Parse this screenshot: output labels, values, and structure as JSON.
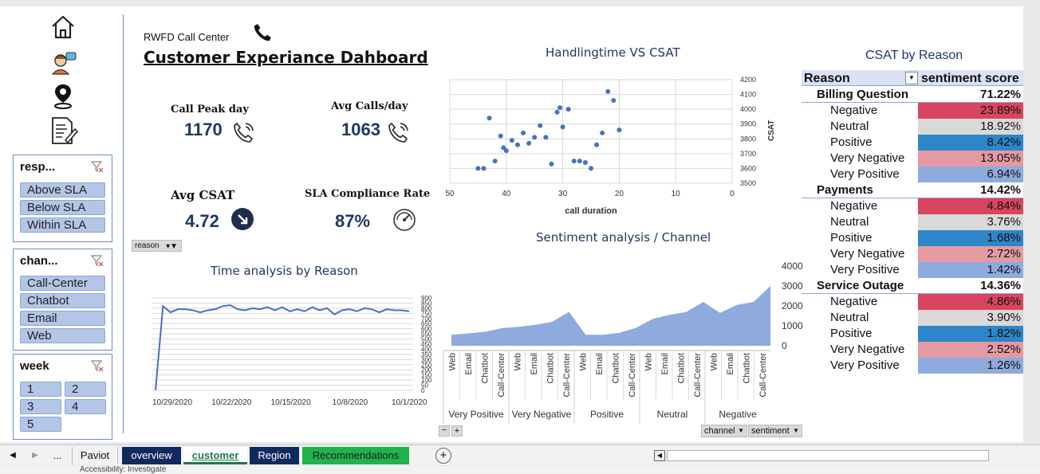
{
  "header": {
    "subtitle": "RWFD Call Center",
    "title": "Customer Experiance Dahboard"
  },
  "kpis": {
    "peak_label": "Call Peak day",
    "peak_value": "1170",
    "avg_calls_label": "Avg Calls/day",
    "avg_calls_value": "1063",
    "csat_label": "Avg CSAT",
    "csat_value": "4.72",
    "sla_label": "SLA Compliance Rate",
    "sla_value": "87%"
  },
  "slicers": {
    "response": {
      "title": "resp...",
      "items": [
        "Above SLA",
        "Below SLA",
        "Within SLA"
      ]
    },
    "channel": {
      "title": "chan...",
      "items": [
        "Call-Center",
        "Chatbot",
        "Email",
        "Web"
      ]
    },
    "week": {
      "title": "week",
      "items": [
        "1",
        "2",
        "3",
        "4",
        "5"
      ]
    }
  },
  "filter_buttons": {
    "reason": "reason",
    "channel": "channel",
    "sentiment": "sentiment"
  },
  "chart_data": [
    {
      "type": "scatter",
      "title": "Handlingtime VS CSAT",
      "xlabel": "call duration",
      "ylabel": "CSAT",
      "xlim": [
        50,
        0
      ],
      "ylim": [
        3500,
        4200
      ],
      "x_ticks": [
        "50",
        "40",
        "30",
        "20",
        "10",
        "0"
      ],
      "y_ticks": [
        "3500",
        "3600",
        "3700",
        "3800",
        "3900",
        "4000",
        "4100",
        "4200"
      ],
      "points": [
        [
          45,
          3600
        ],
        [
          44,
          3600
        ],
        [
          43,
          3940
        ],
        [
          42,
          3650
        ],
        [
          41,
          3820
        ],
        [
          40.5,
          3740
        ],
        [
          40,
          3720
        ],
        [
          39,
          3790
        ],
        [
          38,
          3760
        ],
        [
          37,
          3840
        ],
        [
          36,
          3770
        ],
        [
          35,
          3810
        ],
        [
          34,
          3890
        ],
        [
          33,
          3810
        ],
        [
          32,
          3630
        ],
        [
          31,
          3980
        ],
        [
          30.5,
          4010
        ],
        [
          30,
          3880
        ],
        [
          29,
          4000
        ],
        [
          28,
          3650
        ],
        [
          27,
          3650
        ],
        [
          26,
          3640
        ],
        [
          25,
          3600
        ],
        [
          24,
          3760
        ],
        [
          23,
          3840
        ],
        [
          22,
          4120
        ],
        [
          21,
          4060
        ],
        [
          20,
          3860
        ]
      ]
    },
    {
      "type": "line",
      "title": "Time analysis by Reason",
      "x_ticks": [
        "10/29/2020",
        "10/22/2020",
        "10/15/2020",
        "10/8/2020",
        "10/1/2020"
      ],
      "y_ticks": [
        "0",
        "50",
        "100",
        "150",
        "200",
        "250",
        "300",
        "350",
        "400",
        "450",
        "500",
        "550",
        "600",
        "650",
        "700",
        "750",
        "800",
        "850",
        "900"
      ],
      "ylim": [
        0,
        900
      ],
      "values": [
        0,
        820,
        760,
        790,
        790,
        780,
        760,
        780,
        790,
        820,
        830,
        790,
        780,
        800,
        790,
        810,
        780,
        810,
        770,
        790,
        770,
        810,
        780,
        800,
        740,
        780,
        790,
        770,
        800,
        790,
        760,
        790,
        780,
        780,
        770
      ]
    },
    {
      "type": "area",
      "title": "Sentiment analysis / Channel",
      "ylim": [
        0,
        4000
      ],
      "y_ticks": [
        "0",
        "1000",
        "2000",
        "3000",
        "4000"
      ],
      "groups": [
        "Very Positive",
        "Very Negative",
        "Positive",
        "Neutral",
        "Negative"
      ],
      "categories": [
        "Web",
        "Email",
        "Chatbot",
        "Call-Center",
        "Web",
        "Email",
        "Chatbot",
        "Call-Center",
        "Web",
        "Email",
        "Chatbot",
        "Call-Center",
        "Web",
        "Email",
        "Chatbot",
        "Call-Center",
        "Web",
        "Email",
        "Chatbot",
        "Call-Center"
      ],
      "values": [
        550,
        620,
        700,
        880,
        950,
        1050,
        1200,
        1700,
        550,
        550,
        650,
        900,
        1350,
        1550,
        1700,
        2200,
        1650,
        2050,
        2200,
        3000
      ]
    }
  ],
  "csat_table": {
    "title": "CSAT  by Reason",
    "col_reason": "Reason",
    "col_score": "sentiment score",
    "groups": [
      {
        "name": "Billing Question",
        "total": "71.22%",
        "rows": [
          {
            "label": "Negative",
            "value": "23.89%"
          },
          {
            "label": "Neutral",
            "value": "18.92%"
          },
          {
            "label": "Positive",
            "value": "8.42%"
          },
          {
            "label": "Very Negative",
            "value": "13.05%"
          },
          {
            "label": "Very Positive",
            "value": "6.94%"
          }
        ]
      },
      {
        "name": "Payments",
        "total": "14.42%",
        "rows": [
          {
            "label": "Negative",
            "value": "4.84%"
          },
          {
            "label": "Neutral",
            "value": "3.76%"
          },
          {
            "label": "Positive",
            "value": "1.68%"
          },
          {
            "label": "Very Negative",
            "value": "2.72%"
          },
          {
            "label": "Very Positive",
            "value": "1.42%"
          }
        ]
      },
      {
        "name": "Service Outage",
        "total": "14.36%",
        "rows": [
          {
            "label": "Negative",
            "value": "4.86%"
          },
          {
            "label": "Neutral",
            "value": "3.90%"
          },
          {
            "label": "Positive",
            "value": "1.82%"
          },
          {
            "label": "Very Negative",
            "value": "2.52%"
          },
          {
            "label": "Very Positive",
            "value": "1.26%"
          }
        ]
      }
    ]
  },
  "row_colors": {
    "Negative": "#d9455f",
    "Neutral": "#d9d9d9",
    "Positive": "#2e86c9",
    "Very Negative": "#e39aa3",
    "Very Positive": "#8faadc"
  },
  "tabs": {
    "ellipsis": "...",
    "items": [
      "Paviot",
      "overview",
      "customer",
      "Region",
      "Recommendations"
    ],
    "active": "customer"
  },
  "status_bar": {
    "accessibility": "Accessibility: Investigate"
  },
  "icons": [
    "home-icon",
    "support-agent-icon",
    "location-pin-icon",
    "notes-icon",
    "phone-icon",
    "phone-ringing-icon",
    "arrow-down-right-icon",
    "speedometer-icon",
    "filter-clear-icon",
    "dropdown-arrow-icon",
    "add-sheet-icon"
  ]
}
